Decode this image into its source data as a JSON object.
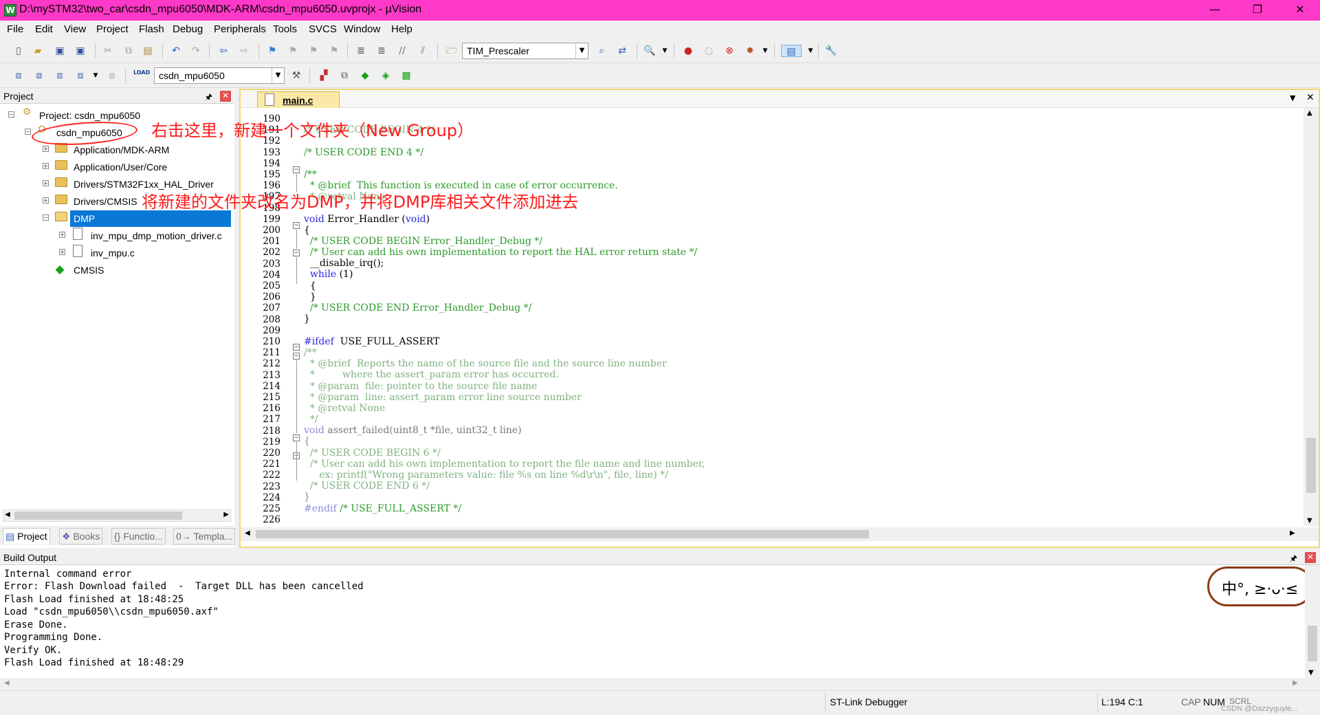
{
  "window": {
    "title": "D:\\mySTM32\\two_car\\csdn_mpu6050\\MDK-ARM\\csdn_mpu6050.uvprojx - µVision",
    "app_icon": "W",
    "minimize_glyph": "—",
    "restore_glyph": "❐",
    "close_glyph": "✕"
  },
  "menu": {
    "items": [
      "File",
      "Edit",
      "View",
      "Project",
      "Flash",
      "Debug",
      "Peripherals",
      "Tools",
      "SVCS",
      "Window",
      "Help"
    ]
  },
  "toolbar": {
    "find_combo_value": "TIM_Prescaler",
    "target_combo_value": "csdn_mpu6050",
    "load_label": "LOAD"
  },
  "project_panel": {
    "title": "Project",
    "pin_glyph": "📌",
    "close_glyph": "✕",
    "tree": {
      "project": "Project: csdn_mpu6050",
      "target": "csdn_mpu6050",
      "groups": [
        "Application/MDK-ARM",
        "Application/User/Core",
        "Drivers/STM32F1xx_HAL_Driver",
        "Drivers/CMSIS",
        "DMP"
      ],
      "dmp_files": [
        "inv_mpu_dmp_motion_driver.c",
        "inv_mpu.c"
      ],
      "cmsis": "CMSIS"
    },
    "tabs": [
      "Project",
      "Books",
      "{} Functio...",
      "0→ Templa..."
    ]
  },
  "editor": {
    "tab_label": "main.c",
    "dropdown_glyph": "▼",
    "close_glyph": "✕",
    "line_numbers": [
      "190",
      "191",
      "192",
      "193",
      "194",
      "195",
      "196",
      "197",
      "198",
      "199",
      "200",
      "201",
      "202",
      "203",
      "204",
      "205",
      "206",
      "207",
      "208",
      "209",
      "210",
      "211",
      "212",
      "213",
      "214",
      "215",
      "216",
      "217",
      "218",
      "219",
      "220",
      "221",
      "222",
      "223",
      "224",
      "225",
      "226"
    ],
    "lines": {
      "l191": "/* USER CODE BEGIN 4 */",
      "l193": "/* USER CODE END 4 */",
      "l195": "/**",
      "l196": "  * @brief  This function is executed in case of error occurrence.",
      "l197": "  * @retval None",
      "l199_kw": "void",
      "l199_rest": " Error_Handler (",
      "l199_kw2": "void",
      "l199_end": ")",
      "l200": "{",
      "l201": "  /* USER CODE BEGIN Error_Handler_Debug */",
      "l202": "  /* User can add his own implementation to report the HAL error return state */",
      "l203": "  __disable_irq();",
      "l204_kw": "  while",
      "l204_rest": " (1)",
      "l205": "  {",
      "l206": "  }",
      "l207": "  /* USER CODE END Error_Handler_Debug */",
      "l208": "}",
      "l210_kw": "#ifdef",
      "l210_rest": "  USE_FULL_ASSERT",
      "l211": "/**",
      "l212": "  * @brief  Reports the name of the source file and the source line number",
      "l213": "  *         where the assert_param error has occurred.",
      "l214": "  * @param  file: pointer to the source file name",
      "l215": "  * @param  line: assert_param error line source number",
      "l216": "  * @retval None",
      "l217": "  */",
      "l218_kw": "void",
      "l218_rest": " assert_failed(uint8_t *file, uint32_t line)",
      "l219": "{",
      "l220": "  /* USER CODE BEGIN 6 */",
      "l221": "  /* User can add his own implementation to report the file name and line number,",
      "l222": "     ex: printf(\"Wrong parameters value: file %s on line %d\\r\\n\", file, line) */",
      "l223": "  /* USER CODE END 6 */",
      "l224": "}",
      "l225_kw": "#endif",
      "l225_rest": " /* USE_FULL_ASSERT */"
    }
  },
  "annotations": {
    "first": "右击这里，新建一个文件夹（New Group）",
    "second": "将新建的文件夹改名为DMP，并将DMP库相关文件添加进去"
  },
  "build_output": {
    "title": "Build Output",
    "lines": [
      "Internal command error",
      "Error: Flash Download failed  -  Target DLL has been cancelled",
      "Flash Load finished at 18:48:25",
      "Load \"csdn_mpu6050\\\\csdn_mpu6050.axf\"",
      "Erase Done.",
      "Programming Done.",
      "Verify OK.",
      "Flash Load finished at 18:48:29"
    ],
    "sticker_text": "中°, ≥·ᴗ·≤"
  },
  "status": {
    "debugger": "ST-Link Debugger",
    "position": "L:194 C:1",
    "cap": "CAP",
    "num": "NUM",
    "scrl": "SCRL",
    "watermark": "CSDN @Dazzyguyle..."
  },
  "colors": {
    "titlebar": "#fe38c7",
    "selection": "#0a78d7",
    "annotation": "#ff1a1a",
    "comment": "#2a9a2a",
    "keyword": "#2929d8"
  }
}
